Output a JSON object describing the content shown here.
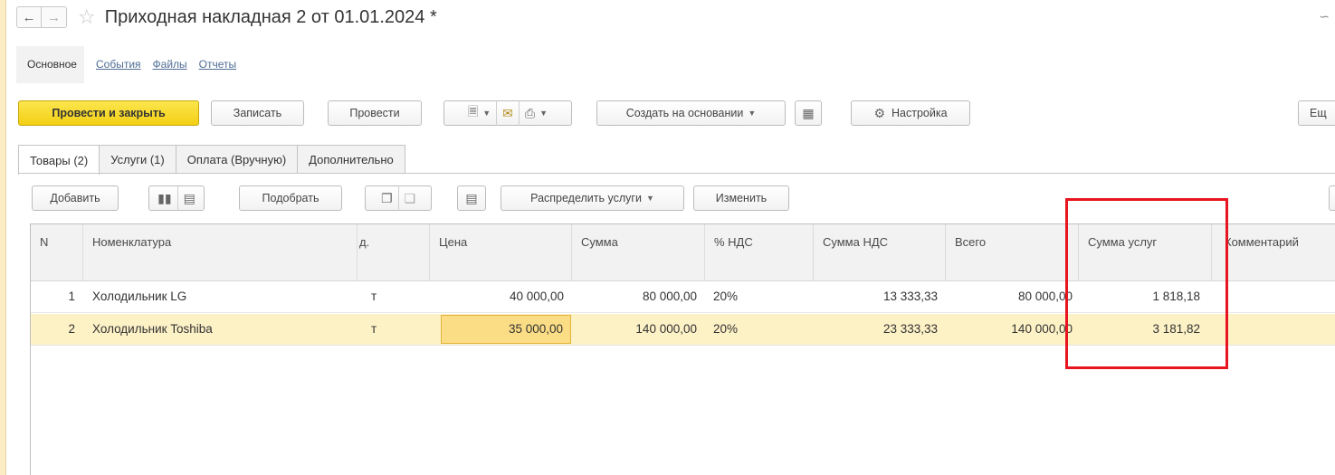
{
  "window": {
    "title": "Приходная накладная 2 от 01.01.2024 *"
  },
  "section_tabs": {
    "main": "Основное",
    "links": [
      "События",
      "Файлы",
      "Отчеты"
    ]
  },
  "toolbar": {
    "post_close": "Провести и закрыть",
    "save": "Записать",
    "post": "Провести",
    "create_based": "Создать на основании",
    "settings": "Настройка",
    "more": "Ещ"
  },
  "form_tabs": [
    "Товары (2)",
    "Услуги (1)",
    "Оплата (Вручную)",
    "Дополнительно"
  ],
  "table_toolbar": {
    "add": "Добавить",
    "pick": "Подобрать",
    "distribute": "Распределить услуги",
    "change": "Изменить"
  },
  "table": {
    "columns": [
      "N",
      "Номенклатура",
      "д.",
      "Цена",
      "Сумма",
      "% НДС",
      "Сумма НДС",
      "Всего",
      "Сумма услуг",
      "Комментарий"
    ],
    "rows": [
      {
        "n": "1",
        "item": "Холодильник LG",
        "unit": "т",
        "price": "40 000,00",
        "sum": "80 000,00",
        "vat_rate": "20%",
        "vat_sum": "13 333,33",
        "total": "80 000,00",
        "services_sum": "1 818,18",
        "comment": ""
      },
      {
        "n": "2",
        "item": "Холодильник Toshiba",
        "unit": "т",
        "price": "35 000,00",
        "sum": "140 000,00",
        "vat_rate": "20%",
        "vat_sum": "23 333,33",
        "total": "140 000,00",
        "services_sum": "3 181,82",
        "comment": ""
      }
    ],
    "selected_row": 2
  },
  "colors": {
    "primary_button": "#f3cf14",
    "selected_row": "#fdf1c6",
    "editing_cell": "#fbdd85",
    "highlight_frame": "#e8141f",
    "link": "#4f6d94"
  },
  "icons": [
    "back-arrow-icon",
    "forward-arrow-icon",
    "favorite-star-icon",
    "link-icon",
    "create-doc-icon",
    "mail-icon",
    "print-icon",
    "structure-icon",
    "gear-icon",
    "barcode-icon",
    "data-collector-icon",
    "copy-icon",
    "paste-icon",
    "table-settings-icon"
  ]
}
